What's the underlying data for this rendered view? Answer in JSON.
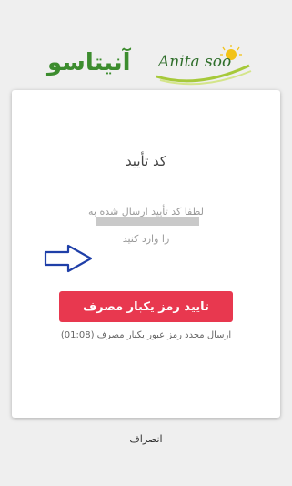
{
  "brand": {
    "name_fa": "آنیتاسو",
    "name_en": "Anita soo"
  },
  "verify": {
    "title": "کد تأیید",
    "message_line1": "لطفا کد تأیید ارسال شده به",
    "message_line2": "را وارد کنید",
    "submit_label": "تایید رمز یکبار مصرف",
    "resend_text": "ارسال مجدد رمز عبور یکبار مصرف (01:08)"
  },
  "footer": {
    "cancel_label": "انصراف"
  },
  "colors": {
    "accent": "#e8384f",
    "brand_green": "#3c8c2e",
    "arrow_blue": "#1f3fa8"
  }
}
